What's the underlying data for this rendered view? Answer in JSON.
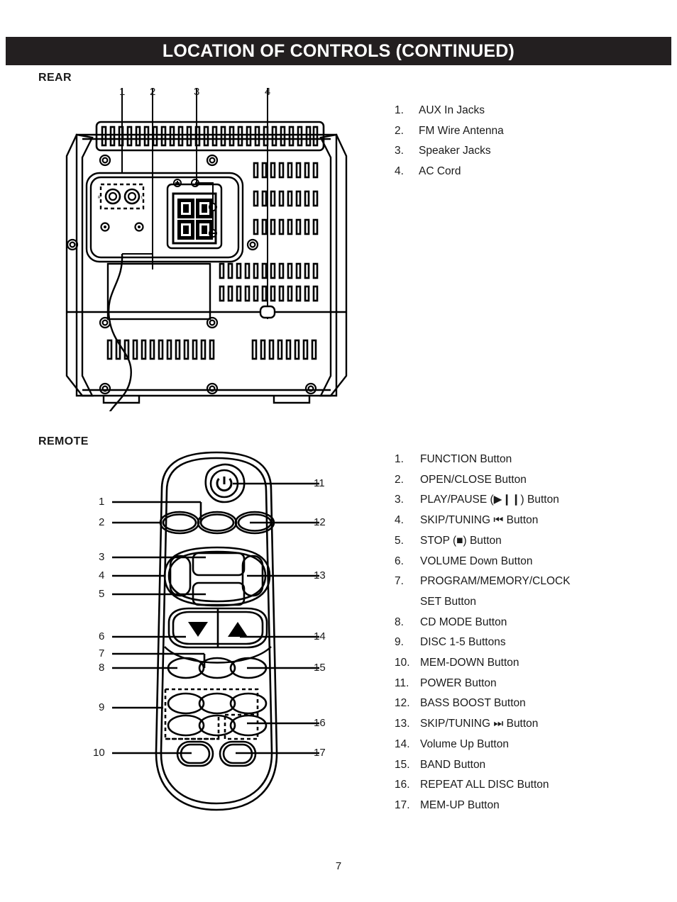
{
  "document": {
    "title": "LOCATION OF CONTROLS (CONTINUED)",
    "page_number": "7"
  },
  "sections": {
    "rear": {
      "label": "REAR",
      "callouts": [
        "1",
        "2",
        "3",
        "4"
      ],
      "legend": [
        {
          "num": "1.",
          "text": "AUX In Jacks"
        },
        {
          "num": "2.",
          "text": "FM Wire Antenna"
        },
        {
          "num": "3.",
          "text": "Speaker Jacks"
        },
        {
          "num": "4.",
          "text": "AC Cord"
        }
      ]
    },
    "remote": {
      "label": "REMOTE",
      "callouts_left": [
        "1",
        "2",
        "3",
        "4",
        "5",
        "6",
        "7",
        "8",
        "9",
        "10"
      ],
      "callouts_right": [
        "11",
        "12",
        "13",
        "14",
        "15",
        "16",
        "17"
      ],
      "legend": [
        {
          "num": "1.",
          "text": "FUNCTION Button"
        },
        {
          "num": "2.",
          "text": "OPEN/CLOSE Button"
        },
        {
          "num": "3.",
          "text": "PLAY/PAUSE (▶❙❙) Button"
        },
        {
          "num": "4.",
          "text": "SKIP/TUNING ⏮ Button"
        },
        {
          "num": "5.",
          "text": "STOP (■) Button"
        },
        {
          "num": "6.",
          "text": "VOLUME Down Button"
        },
        {
          "num": "7.",
          "text": "PROGRAM/MEMORY/CLOCK",
          "cont": "SET Button"
        },
        {
          "num": "8.",
          "text": "CD MODE Button"
        },
        {
          "num": "9.",
          "text": "DISC 1-5 Buttons"
        },
        {
          "num": "10.",
          "text": "MEM-DOWN Button"
        },
        {
          "num": "11.",
          "text": "POWER Button"
        },
        {
          "num": "12.",
          "text": "BASS BOOST Button"
        },
        {
          "num": "13.",
          "text": "SKIP/TUNING ⏭ Button"
        },
        {
          "num": "14.",
          "text": "Volume Up Button"
        },
        {
          "num": "15.",
          "text": "BAND Button"
        },
        {
          "num": "16.",
          "text": "REPEAT ALL DISC Button"
        },
        {
          "num": "17.",
          "text": "MEM-UP Button"
        }
      ]
    }
  },
  "colors": {
    "banner_background": "#231f20",
    "banner_text": "#ffffff",
    "line": "#000000",
    "page_background": "#ffffff"
  }
}
